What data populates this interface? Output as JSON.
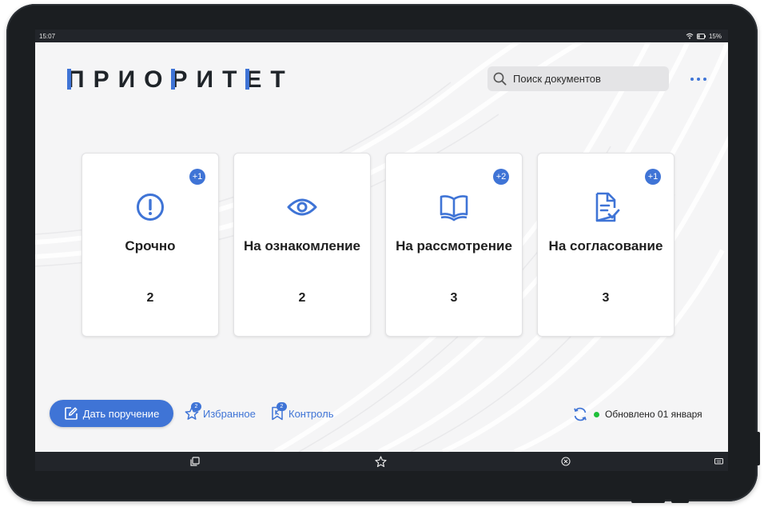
{
  "statusbar": {
    "time": "15:07",
    "battery": "15%"
  },
  "app": {
    "logo": [
      "П",
      "Р",
      "И",
      "О",
      "Р",
      "И",
      "Т",
      "Е",
      "Т"
    ],
    "search": {
      "placeholder": "Поиск документов"
    }
  },
  "cards": [
    {
      "title": "Срочно",
      "count": "2",
      "badge": "+1",
      "icon": "alert-circle-icon"
    },
    {
      "title": "На ознакомление",
      "count": "2",
      "badge": "",
      "icon": "eye-icon"
    },
    {
      "title": "На рассмотрение",
      "count": "3",
      "badge": "+2",
      "icon": "open-book-icon"
    },
    {
      "title": "На согласование",
      "count": "3",
      "badge": "+1",
      "icon": "document-check-icon"
    }
  ],
  "bottom": {
    "assign_label": "Дать поручение",
    "favorites": {
      "label": "Избранное",
      "badge": "2"
    },
    "control": {
      "label": "Контроль",
      "badge": "2"
    },
    "sync_status": "Обновлено 01 января"
  },
  "colors": {
    "accent": "#3f74d6",
    "online": "#1fbf3a",
    "frame": "#1b1e21"
  }
}
